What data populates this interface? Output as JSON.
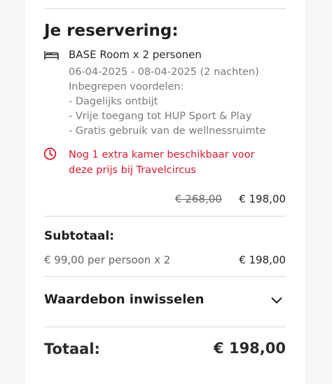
{
  "reservation": {
    "title": "Je reservering:",
    "room_line": "BASE Room x 2 personen",
    "dates": "06-04-2025 - 08-04-2025 (2 nachten)",
    "benefits_heading": "Inbegrepen voordelen:",
    "benefits": [
      "- Dagelijks ontbijt",
      "- Vrije toegang tot HUP Sport & Play",
      "- Gratis gebruik van de wellnessruimte"
    ],
    "availability": [
      "Nog 1 extra kamer beschikbaar voor",
      "deze prijs bij Travelcircus"
    ],
    "old_price": "€ 268,00",
    "price": "€ 198,00"
  },
  "subtotal": {
    "label": "Subtotaal:",
    "per_person": "€ 99,00 per persoon x 2",
    "amount": "€ 198,00"
  },
  "voucher": {
    "label": "Waardebon inwisselen",
    "icon": "chevron-down-icon"
  },
  "total": {
    "label": "Totaal:",
    "amount": "€ 198,00"
  },
  "colors": {
    "accent_red": "#e3182d",
    "text": "#1f1f1f",
    "muted": "#7a7a7a",
    "divider": "#d9d9d9"
  },
  "icons": {
    "bed": "bed-icon",
    "clock": "clock-icon"
  }
}
